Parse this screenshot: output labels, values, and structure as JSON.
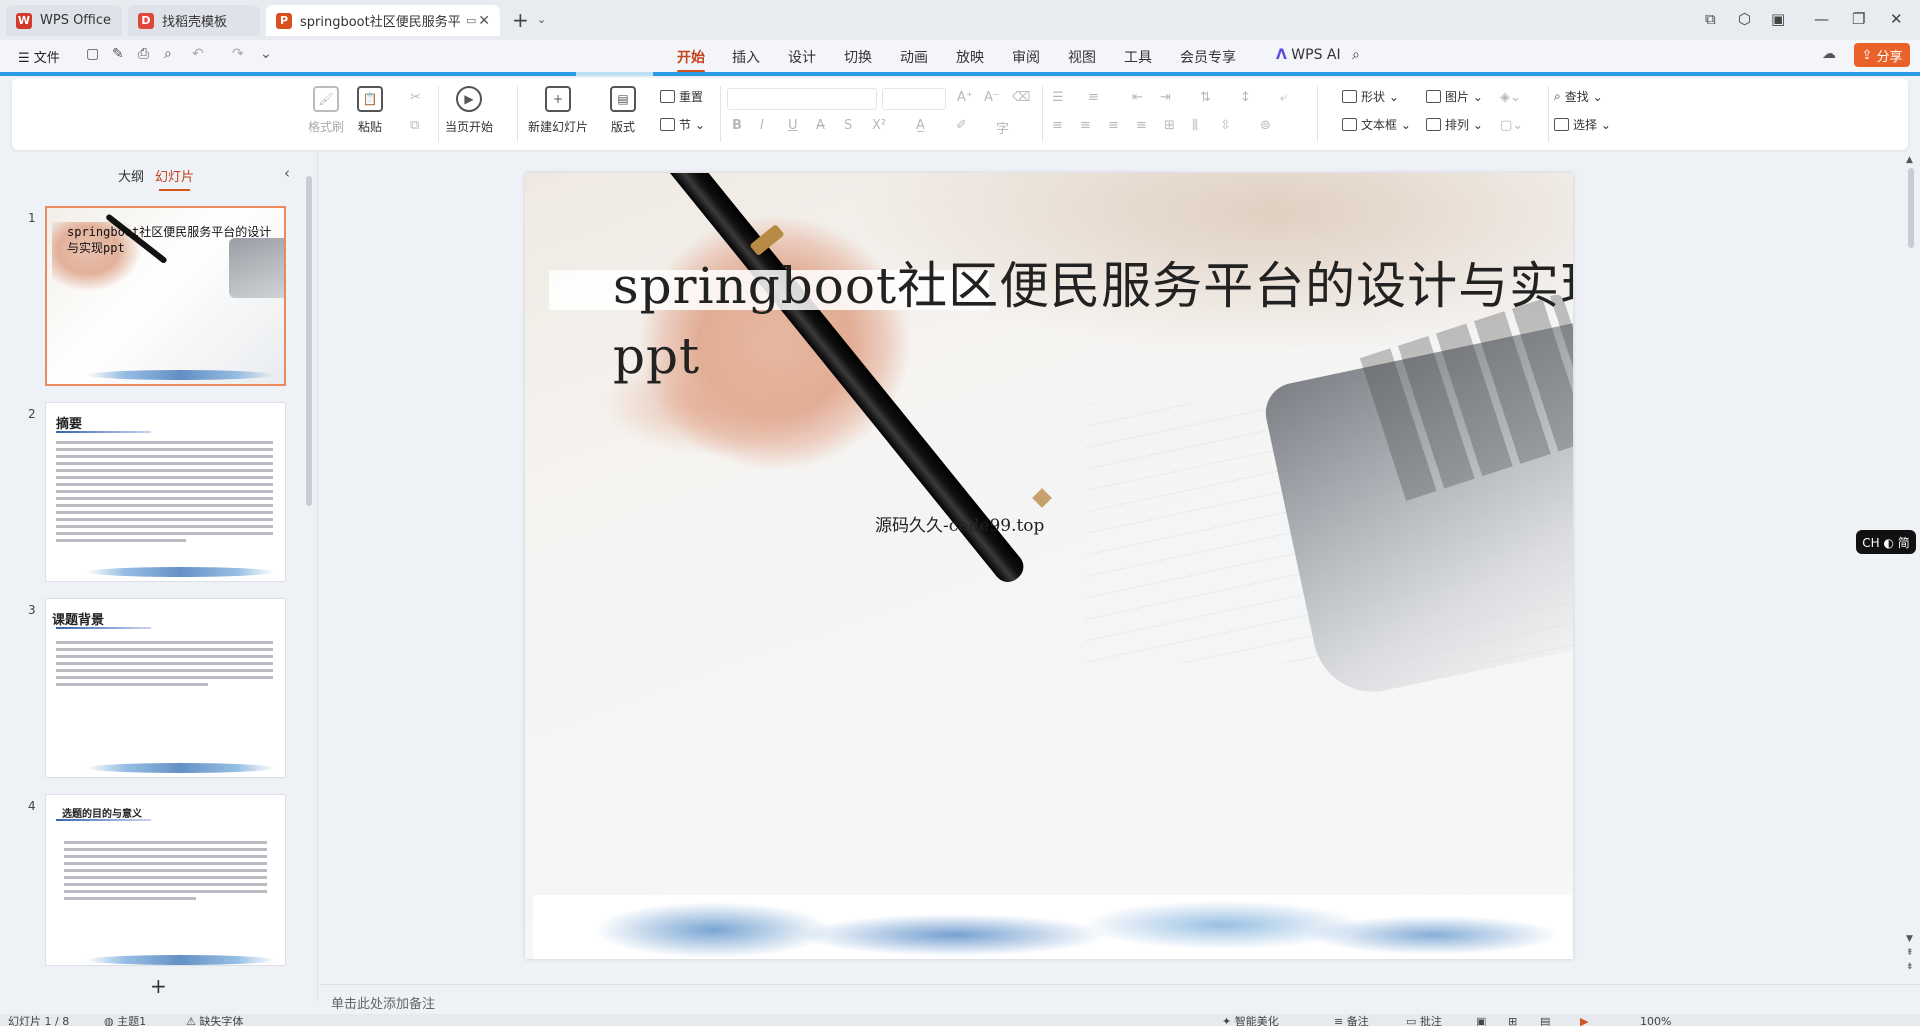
{
  "tabs": [
    {
      "label": "WPS Office",
      "icon": "wps-logo-icon"
    },
    {
      "label": "找稻壳模板",
      "icon": "docer-icon"
    },
    {
      "label": "springboot社区便民服务平...",
      "icon": "ppt-icon"
    }
  ],
  "menu": {
    "file": "文件",
    "tabs": [
      "开始",
      "插入",
      "设计",
      "切换",
      "动画",
      "放映",
      "审阅",
      "视图",
      "工具",
      "会员专享"
    ],
    "active_tab": "开始",
    "wps_ai": "WPS AI",
    "share": "分享"
  },
  "ribbon": {
    "format_painter": "格式刷",
    "paste": "粘贴",
    "play_from_current": "当页开始",
    "new_slide": "新建幻灯片",
    "layout": "版式",
    "section": "节",
    "reset": "重置",
    "shape": "形状",
    "picture": "图片",
    "find": "查找",
    "textbox": "文本框",
    "arrange": "排列",
    "select": "选择"
  },
  "left_panel": {
    "tab_outline": "大纲",
    "tab_slides": "幻灯片",
    "active_tab": "幻灯片",
    "slides": [
      {
        "num": "1",
        "title": "springboot社区便民服务平台的设计与实现ppt"
      },
      {
        "num": "2",
        "title": "摘要"
      },
      {
        "num": "3",
        "title": "课题背景"
      },
      {
        "num": "4",
        "title": "选题的目的与意义"
      }
    ]
  },
  "slide": {
    "title": "springboot社区便民服务平台的设计与实现ppt",
    "subtitle": "源码久久-code99.top"
  },
  "ime": "CH ◐ 简",
  "notes_placeholder": "单击此处添加备注",
  "statusbar": {
    "slide_info": "幻灯片 1 / 8",
    "theme": "主题1",
    "missing_font": "缺失字体",
    "smart_beautify": "智能美化",
    "notes": "备注",
    "comments": "批注",
    "zoom": "100%"
  },
  "colors": {
    "accent": "#d4531e",
    "share": "#e8622a",
    "progress": "#2a9be6"
  }
}
